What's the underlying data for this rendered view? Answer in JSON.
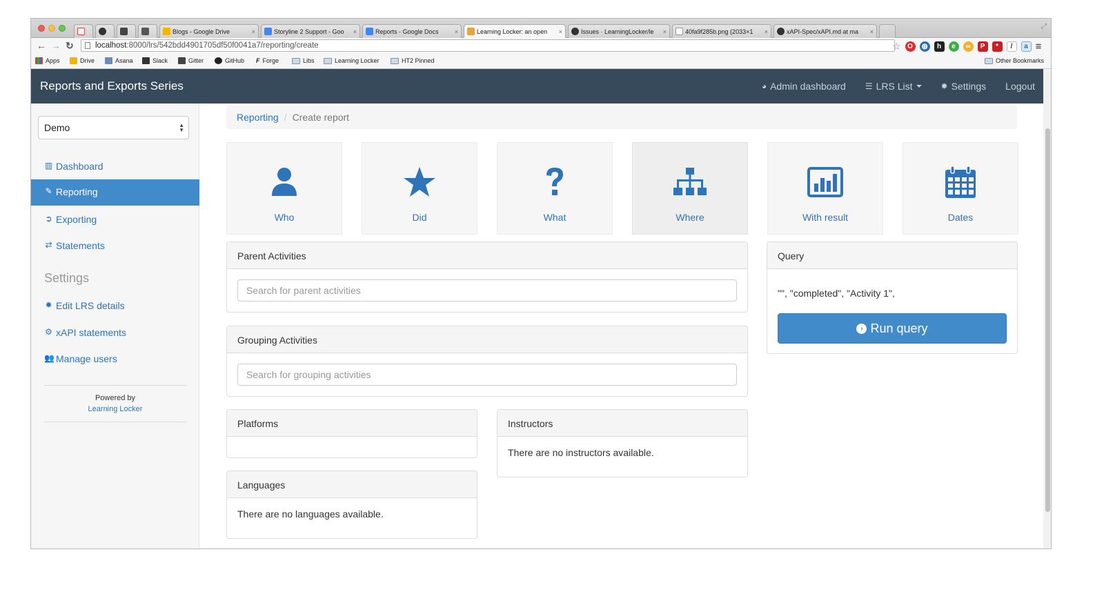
{
  "browser": {
    "tabs": [
      {
        "title": "",
        "color": "#d44638"
      },
      {
        "title": "",
        "color": "#333333"
      },
      {
        "title": "",
        "color": "#444444"
      },
      {
        "title": "",
        "color": "#555555"
      },
      {
        "title": "Blogs - Google Drive",
        "color": "#f4b400"
      },
      {
        "title": "Storyline 2 Support - Goo",
        "color": "#4285f4"
      },
      {
        "title": "Reports - Google Docs",
        "color": "#4285f4"
      },
      {
        "title": "Learning Locker: an open",
        "color": "#e8a23c"
      },
      {
        "title": "Issues · LearningLocker/le",
        "color": "#333333"
      },
      {
        "title": "40fa9f285b.png (2033×1",
        "color": "#ffffff"
      },
      {
        "title": "xAPI-Spec/xAPI.md at ma",
        "color": "#333333"
      }
    ],
    "url_host": "localhost",
    "url_path": ":8000/lrs/542bdd4901705df50f0041a7/reporting/create",
    "bookmarks": [
      "Apps",
      "Drive",
      "Asana",
      "Slack",
      "Gitter",
      "GitHub",
      "Forge",
      "Libs",
      "Learning Locker",
      "HT2 Pinned"
    ],
    "other_bookmarks": "Other Bookmarks"
  },
  "navbar": {
    "brand": "Reports and Exports Series",
    "admin": "Admin dashboard",
    "lrs_list": "LRS List",
    "settings": "Settings",
    "logout": "Logout"
  },
  "sidebar": {
    "lrs_selected": "Demo",
    "items": [
      {
        "label": "Dashboard",
        "icon": "bar-chart-icon"
      },
      {
        "label": "Reporting",
        "icon": "pencil-icon"
      },
      {
        "label": "Exporting",
        "icon": "circle-arrow-icon"
      },
      {
        "label": "Statements",
        "icon": "exchange-icon"
      }
    ],
    "settings_heading": "Settings",
    "settings_items": [
      {
        "label": "Edit LRS details",
        "icon": "gear-icon"
      },
      {
        "label": "xAPI statements",
        "icon": "gears-icon"
      },
      {
        "label": "Manage users",
        "icon": "users-icon"
      }
    ],
    "powered_by": "Powered by",
    "powered_link": "Learning Locker"
  },
  "breadcrumb": {
    "link": "Reporting",
    "sep": "/",
    "current": "Create report"
  },
  "tiles": [
    {
      "label": "Who",
      "icon": "user-icon"
    },
    {
      "label": "Did",
      "icon": "star-icon"
    },
    {
      "label": "What",
      "icon": "question-icon"
    },
    {
      "label": "Where",
      "icon": "sitemap-icon"
    },
    {
      "label": "With result",
      "icon": "bar-chart-icon"
    },
    {
      "label": "Dates",
      "icon": "calendar-icon"
    }
  ],
  "panels": {
    "parent": {
      "title": "Parent Activities",
      "placeholder": "Search for parent activities"
    },
    "grouping": {
      "title": "Grouping Activities",
      "placeholder": "Search for grouping activities"
    },
    "platforms": {
      "title": "Platforms"
    },
    "instructors": {
      "title": "Instructors",
      "empty": "There are no instructors available."
    },
    "languages": {
      "title": "Languages",
      "empty": "There are no languages available."
    },
    "query": {
      "title": "Query",
      "text": "\"\", \"completed\", \"Activity 1\",",
      "button": "Run query"
    }
  },
  "colors": {
    "navbar": "#364a5b",
    "accent": "#2f73b8",
    "active": "#428bca"
  }
}
